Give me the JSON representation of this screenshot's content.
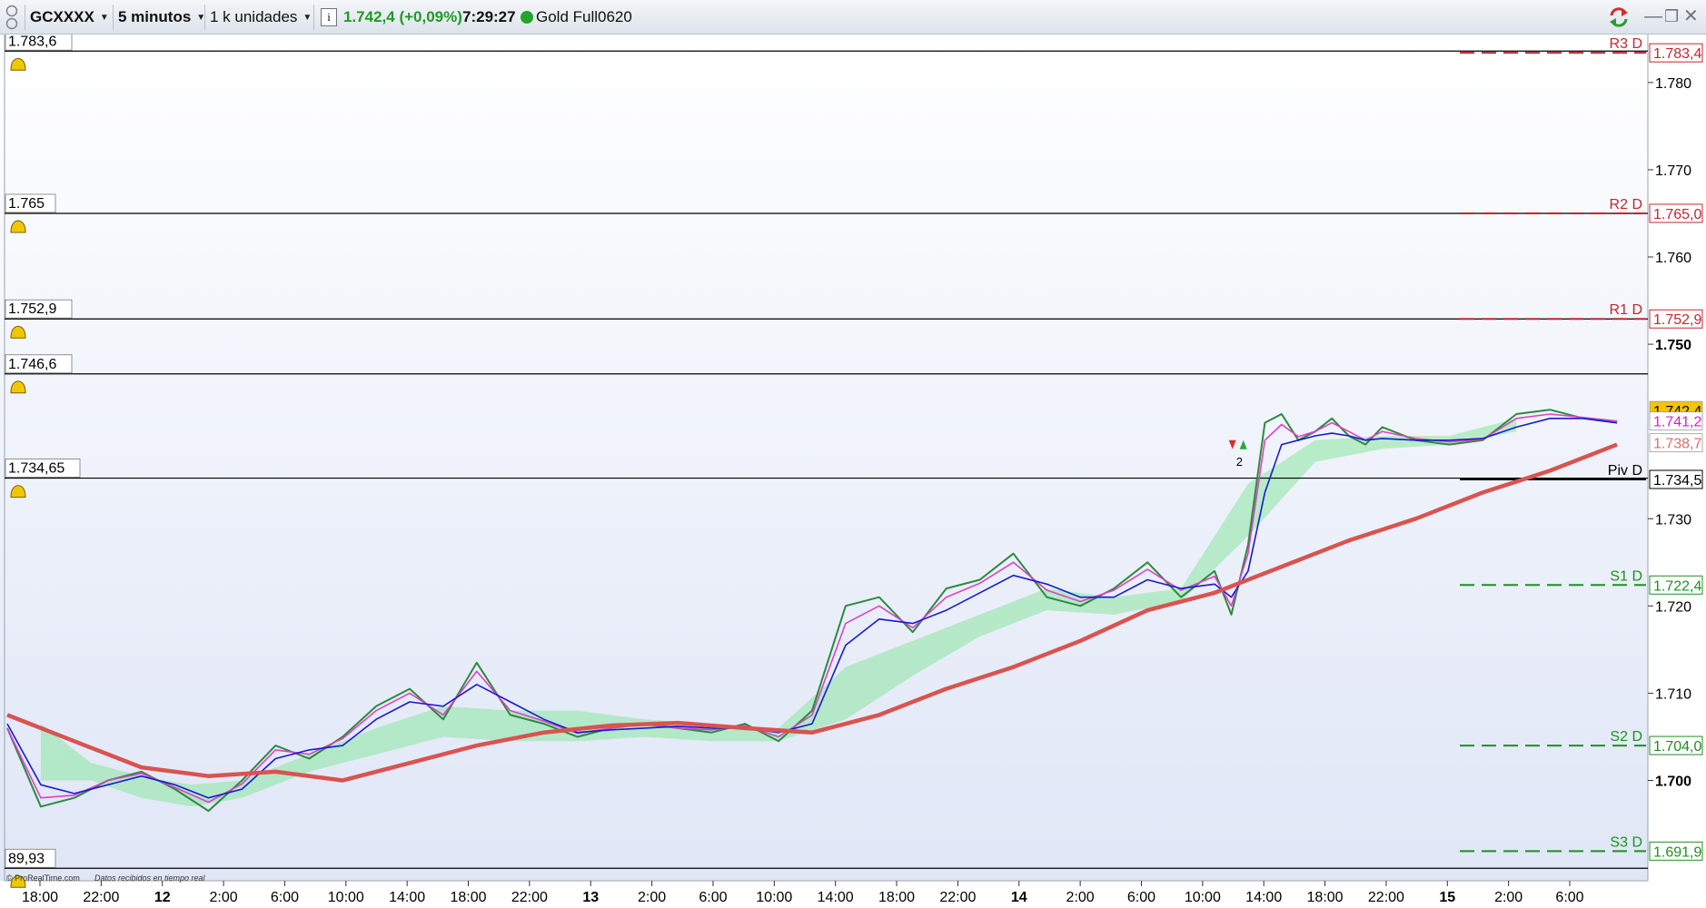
{
  "toolbar": {
    "symbol": "GCXXXX",
    "timeframe": "5 minutos",
    "units": "1 k unidades",
    "price_change": "1.742,4 (+0,09%)",
    "time": "7:29:27",
    "contract": "Gold Full0620",
    "status_color": "#22a52a",
    "icons": [
      "grip-icon",
      "dropdown-icon",
      "info-icon",
      "refresh-icon",
      "minimize-icon",
      "restore-icon",
      "close-icon"
    ]
  },
  "footer": {
    "credit": "© ProRealTime.com",
    "status": "Datos recibidos en tiempo real"
  },
  "chart_data": {
    "type": "line",
    "symbol": "GCXXXX",
    "timeframe": "5 minutos",
    "ylim": [
      1688.5,
      1785.5
    ],
    "y_ticks": [
      {
        "value": 1780,
        "label": "1.780",
        "bold": false
      },
      {
        "value": 1770,
        "label": "1.770",
        "bold": false
      },
      {
        "value": 1760,
        "label": "1.760",
        "bold": false
      },
      {
        "value": 1750,
        "label": "1.750",
        "bold": true
      },
      {
        "value": 1730,
        "label": "1.730",
        "bold": false
      },
      {
        "value": 1720,
        "label": "1.720",
        "bold": false
      },
      {
        "value": 1710,
        "label": "1.710",
        "bold": false
      },
      {
        "value": 1700,
        "label": "1.700",
        "bold": true
      }
    ],
    "x_ticks": [
      {
        "label": "18:00",
        "bold": false
      },
      {
        "label": "22:00",
        "bold": false
      },
      {
        "label": "12",
        "bold": true
      },
      {
        "label": "2:00",
        "bold": false
      },
      {
        "label": "6:00",
        "bold": false
      },
      {
        "label": "10:00",
        "bold": false
      },
      {
        "label": "14:00",
        "bold": false
      },
      {
        "label": "18:00",
        "bold": false
      },
      {
        "label": "22:00",
        "bold": false
      },
      {
        "label": "13",
        "bold": true
      },
      {
        "label": "2:00",
        "bold": false
      },
      {
        "label": "6:00",
        "bold": false
      },
      {
        "label": "10:00",
        "bold": false
      },
      {
        "label": "14:00",
        "bold": false
      },
      {
        "label": "18:00",
        "bold": false
      },
      {
        "label": "22:00",
        "bold": false
      },
      {
        "label": "14",
        "bold": true
      },
      {
        "label": "2:00",
        "bold": false
      },
      {
        "label": "6:00",
        "bold": false
      },
      {
        "label": "10:00",
        "bold": false
      },
      {
        "label": "14:00",
        "bold": false
      },
      {
        "label": "18:00",
        "bold": false
      },
      {
        "label": "22:00",
        "bold": false
      },
      {
        "label": "15",
        "bold": true
      },
      {
        "label": "2:00",
        "bold": false
      },
      {
        "label": "6:00",
        "bold": false
      }
    ],
    "pivots": [
      {
        "name": "R3 D",
        "value": 1783.4,
        "label": "1.783,4",
        "color": "#c0272d"
      },
      {
        "name": "R2 D",
        "value": 1765.0,
        "label": "1.765,0",
        "color": "#c0272d"
      },
      {
        "name": "R1 D",
        "value": 1752.9,
        "label": "1.752,9",
        "color": "#c0272d"
      },
      {
        "name": "Piv D",
        "value": 1734.5,
        "label": "1.734,5",
        "color": "#000000"
      },
      {
        "name": "S1 D",
        "value": 1722.4,
        "label": "1.722,4",
        "color": "#1f8f1f"
      },
      {
        "name": "S2 D",
        "value": 1704.0,
        "label": "1.704,0",
        "color": "#1f8f1f"
      },
      {
        "name": "S3 D",
        "value": 1691.9,
        "label": "1.691,9",
        "color": "#1f8f1f"
      }
    ],
    "alerts": [
      {
        "value": 1783.6,
        "label": "1.783,6"
      },
      {
        "value": 1765.0,
        "label": "1.765"
      },
      {
        "value": 1752.9,
        "label": "1.752,9"
      },
      {
        "value": 1746.6,
        "label": "1.746,6"
      },
      {
        "value": 1734.65,
        "label": "1.734,65"
      },
      {
        "value": 1689.93,
        "label": "89,93"
      }
    ],
    "price_badges": [
      {
        "value": 1742.4,
        "label": "1.742,4",
        "bg": "#f5c400",
        "fg": "#000000"
      },
      {
        "value": 1741.2,
        "label": "1.741,2",
        "bg": "#ffffff",
        "fg": "#d020c8"
      },
      {
        "value": 1738.7,
        "label": "1.738,7",
        "bg": "#ffffff",
        "fg": "#e06a6a"
      }
    ],
    "trade_marker": {
      "label": "2",
      "value": 1736.5
    },
    "series": [
      {
        "name": "price",
        "color": "#2c8a3e",
        "x": [
          0,
          2,
          4,
          6,
          8,
          10,
          12,
          14,
          16,
          18,
          20,
          22,
          24,
          26,
          28,
          30,
          32,
          34,
          36,
          38,
          40,
          42,
          44,
          46,
          48,
          50,
          52,
          54,
          56,
          58,
          60,
          62,
          64,
          66,
          68,
          70,
          72,
          73,
          74,
          75,
          76,
          77,
          78,
          79,
          80,
          81,
          82,
          84,
          86,
          88,
          90,
          92,
          94,
          96
        ],
        "values": [
          1706.0,
          1697.0,
          1698.0,
          1700.0,
          1701.0,
          1699.0,
          1696.5,
          1700.0,
          1704.0,
          1702.5,
          1705.0,
          1708.5,
          1710.5,
          1707.0,
          1713.5,
          1707.5,
          1706.5,
          1705.0,
          1706.0,
          1706.5,
          1706.0,
          1705.5,
          1706.5,
          1704.5,
          1708.0,
          1720.0,
          1721.0,
          1717.0,
          1722.0,
          1723.0,
          1726.0,
          1721.0,
          1720.0,
          1722.0,
          1725.0,
          1721.0,
          1724.0,
          1719.0,
          1727.0,
          1741.0,
          1742.0,
          1739.0,
          1740.0,
          1741.5,
          1739.5,
          1738.5,
          1740.5,
          1739.0,
          1738.5,
          1739.0,
          1742.0,
          1742.5,
          1741.5,
          1741.0
        ]
      },
      {
        "name": "fast-ma",
        "color": "#e040c8",
        "x": [
          0,
          2,
          4,
          6,
          8,
          10,
          12,
          14,
          16,
          18,
          20,
          22,
          24,
          26,
          28,
          30,
          32,
          34,
          36,
          38,
          40,
          42,
          44,
          46,
          48,
          50,
          52,
          54,
          56,
          58,
          60,
          62,
          64,
          66,
          68,
          70,
          72,
          73,
          74,
          75,
          76,
          77,
          78,
          79,
          80,
          81,
          82,
          84,
          86,
          88,
          90,
          92,
          94,
          96
        ],
        "values": [
          1706.0,
          1698.0,
          1698.3,
          1700.0,
          1700.8,
          1699.2,
          1697.5,
          1699.6,
          1703.5,
          1703.0,
          1704.8,
          1708.0,
          1710.0,
          1707.5,
          1712.5,
          1708.0,
          1706.8,
          1705.4,
          1706.0,
          1706.4,
          1706.0,
          1705.8,
          1706.3,
          1705.0,
          1707.5,
          1718.0,
          1720.0,
          1717.5,
          1721.0,
          1722.6,
          1725.0,
          1721.8,
          1720.5,
          1721.8,
          1724.2,
          1721.8,
          1723.4,
          1720.0,
          1726.0,
          1739.0,
          1740.8,
          1739.4,
          1740.0,
          1741.0,
          1740.0,
          1739.0,
          1740.0,
          1739.2,
          1738.8,
          1739.1,
          1741.5,
          1742.0,
          1741.6,
          1741.2
        ]
      },
      {
        "name": "kijun",
        "color": "#1a1ad0",
        "x": [
          0,
          2,
          4,
          6,
          8,
          10,
          12,
          14,
          16,
          18,
          20,
          22,
          24,
          26,
          28,
          30,
          32,
          34,
          36,
          38,
          40,
          42,
          44,
          46,
          48,
          50,
          52,
          54,
          56,
          58,
          60,
          62,
          64,
          66,
          68,
          70,
          72,
          73,
          74,
          75,
          76,
          77,
          78,
          79,
          80,
          81,
          82,
          84,
          86,
          88,
          90,
          92,
          94,
          96
        ],
        "values": [
          1706.5,
          1699.5,
          1698.5,
          1699.5,
          1700.5,
          1699.5,
          1698.0,
          1699.0,
          1702.5,
          1703.5,
          1704.0,
          1707.0,
          1709.0,
          1708.5,
          1711.0,
          1709.0,
          1707.0,
          1705.5,
          1705.8,
          1706.0,
          1706.2,
          1706.0,
          1706.0,
          1705.5,
          1706.5,
          1715.5,
          1718.5,
          1718.0,
          1719.5,
          1721.5,
          1723.5,
          1722.5,
          1721.0,
          1721.0,
          1723.0,
          1722.0,
          1722.5,
          1721.0,
          1724.0,
          1733.0,
          1738.5,
          1739.0,
          1739.5,
          1739.8,
          1739.5,
          1739.0,
          1739.2,
          1739.0,
          1739.0,
          1739.2,
          1740.5,
          1741.5,
          1741.5,
          1741.0
        ]
      },
      {
        "name": "long-ma",
        "color": "#d9534f",
        "x": [
          0,
          4,
          8,
          12,
          16,
          20,
          24,
          28,
          32,
          36,
          40,
          44,
          48,
          52,
          56,
          60,
          64,
          68,
          72,
          76,
          80,
          84,
          88,
          92,
          96
        ],
        "values": [
          1707.5,
          1704.5,
          1701.5,
          1700.5,
          1701.0,
          1700.0,
          1702.0,
          1704.0,
          1705.5,
          1706.3,
          1706.6,
          1706.0,
          1705.5,
          1707.5,
          1710.5,
          1713.0,
          1716.0,
          1719.5,
          1721.5,
          1724.5,
          1727.5,
          1730.0,
          1733.0,
          1735.5,
          1738.5
        ]
      }
    ],
    "cloud": [
      {
        "color": "#8ae6a0",
        "x": [
          2,
          5,
          8,
          11,
          14,
          18,
          22,
          26,
          30,
          34,
          38,
          42,
          46,
          50,
          54,
          58,
          62,
          66,
          70,
          74,
          78,
          82,
          86,
          90
        ],
        "upper": [
          1706.5,
          1702.0,
          1700.5,
          1699.5,
          1700.0,
          1703.0,
          1706.0,
          1708.5,
          1708.0,
          1708.0,
          1707.0,
          1706.5,
          1706.0,
          1713.0,
          1716.0,
          1719.0,
          1722.0,
          1721.0,
          1722.0,
          1734.0,
          1739.0,
          1739.5,
          1739.5,
          1741.5
        ],
        "lower": [
          1700.0,
          1700.0,
          1698.0,
          1697.0,
          1698.0,
          1701.0,
          1703.0,
          1705.0,
          1704.5,
          1704.5,
          1705.0,
          1704.5,
          1704.5,
          1707.0,
          1712.0,
          1716.5,
          1719.5,
          1719.0,
          1720.5,
          1728.0,
          1736.5,
          1738.0,
          1738.5,
          1740.0
        ]
      }
    ]
  }
}
